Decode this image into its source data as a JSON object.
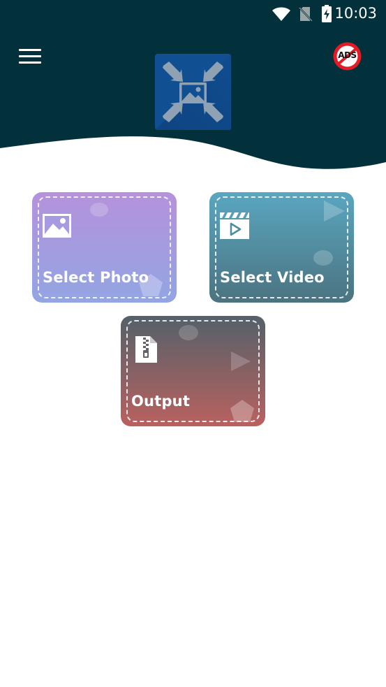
{
  "status_bar": {
    "time": "10:03",
    "icons": [
      "wifi-icon",
      "no-sim-icon",
      "battery-charging-icon"
    ]
  },
  "header": {
    "background_color": "#02303b",
    "menu_icon": "hamburger-menu-icon",
    "ads_icon": "no-ads-icon",
    "ads_text": "ADS",
    "logo_icon": "image-compress-icon"
  },
  "cards": {
    "select_photo": {
      "label": "Select Photo",
      "icon": "image-icon"
    },
    "select_video": {
      "label": "Select Video",
      "icon": "video-clapper-icon"
    },
    "output": {
      "label": "Output",
      "icon": "zip-file-icon"
    }
  }
}
